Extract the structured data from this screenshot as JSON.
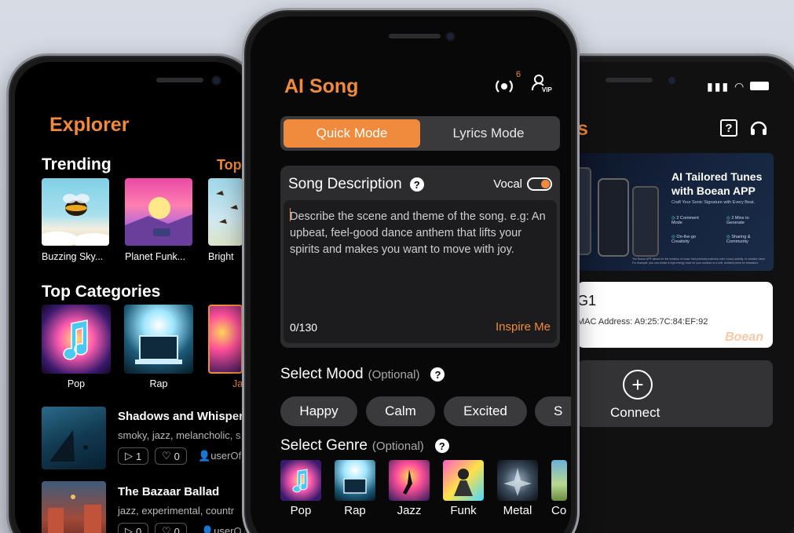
{
  "left_screen": {
    "title": "Explorer",
    "trending_label": "Trending",
    "top_label": "Top",
    "trending": [
      {
        "caption": "Buzzing Sky..."
      },
      {
        "caption": "Planet Funk..."
      },
      {
        "caption": "Bright"
      }
    ],
    "categories_label": "Top Categories",
    "categories": [
      {
        "label": "Pop"
      },
      {
        "label": "Rap"
      },
      {
        "label": "Ja"
      }
    ],
    "songs": [
      {
        "title": "Shadows and Whisper",
        "tags": "smoky, jazz, melancholic, s",
        "plays": "1",
        "likes": "0",
        "user": "userOf"
      },
      {
        "title": "The Bazaar Ballad",
        "tags": "jazz, experimental, countr",
        "plays": "0",
        "likes": "0",
        "user": "userO"
      }
    ]
  },
  "center_screen": {
    "title": "AI Song",
    "notification_count": "6",
    "vip_label": "VIP",
    "modes": {
      "quick": "Quick Mode",
      "lyrics": "Lyrics Mode"
    },
    "description": {
      "label": "Song Description",
      "help": "?",
      "vocal_label": "Vocal",
      "placeholder": "Describe the scene and theme of the song. e.g: An upbeat, feel-good dance anthem that lifts your spirits and makes you want to move with joy.",
      "counter": "0/130",
      "inspire": "Inspire Me"
    },
    "mood": {
      "label": "Select Mood",
      "optional": "(Optional)",
      "options": [
        "Happy",
        "Calm",
        "Excited",
        "S"
      ]
    },
    "genre": {
      "label": "Select Genre",
      "optional": "(Optional)",
      "options": [
        "Pop",
        "Rap",
        "Jazz",
        "Funk",
        "Metal",
        "Co"
      ]
    }
  },
  "right_screen": {
    "title_partial": "s",
    "banner": {
      "headline_1": "AI Tailored Tunes",
      "headline_2": "with Boean APP",
      "subtitle": "Craft Your Sonic Signature with Every Beat.",
      "features": [
        "2 Comment Mode",
        "2 Mins to Generate",
        "On-the-go Creativity",
        "Sharing & Community"
      ],
      "footnote": "The Boean APP allows for the creation of music that precisely matches one's mood, activity, or creative vision. For example, you can create a high-energy track for your workout or a soft, ambient piece for relaxation."
    },
    "device": {
      "name": "G1",
      "mac": "MAC Address: A9:25:7C:84:EF:92",
      "brand": "Boean"
    },
    "connect_label": "Connect"
  },
  "colors": {
    "accent": "#f08a3c",
    "surface": "#2c2c2e",
    "background": "#000000"
  }
}
